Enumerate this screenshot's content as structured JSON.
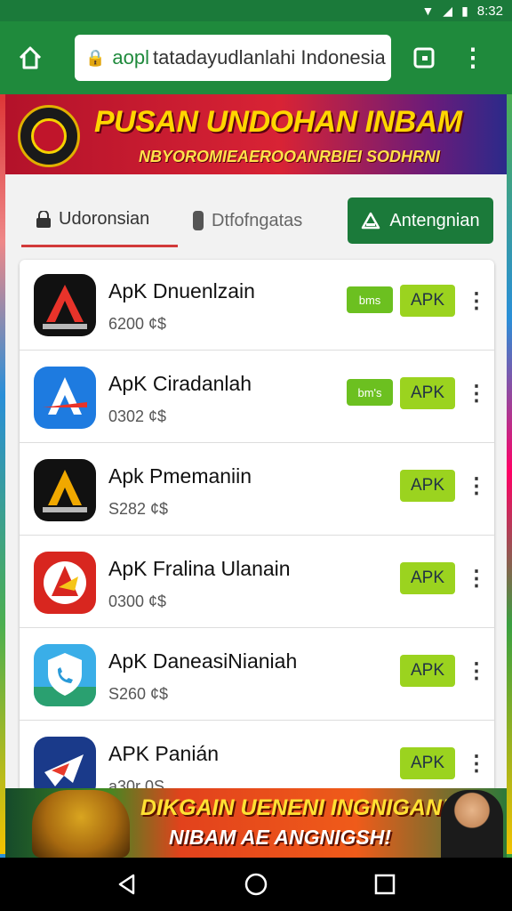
{
  "status_bar": {
    "time": "8:32"
  },
  "browser": {
    "url_scheme": "aopl",
    "url_text": "tatadayudlanlahi Indonesia"
  },
  "banner_top": {
    "title": "PUSAN UNDOHAN INBAM",
    "subtitle": "NBYOROMIEAEROOANRBIEI SODHRNI"
  },
  "tabs": [
    {
      "label": "Udoronsian",
      "icon": "lock-icon"
    },
    {
      "label": "Dtfofngatas",
      "icon": "phone-icon"
    }
  ],
  "download_button": {
    "label": "Antengnian",
    "icon": "triangle-icon"
  },
  "apps": [
    {
      "name": "ApK Dnuenlzain",
      "size": "6200 ¢$",
      "tag": "bms",
      "button": "APK",
      "icon_colors": [
        "#111",
        "#e8332a"
      ]
    },
    {
      "name": "ApK Ciradanlah",
      "size": "0302 ¢$",
      "tag": "bm's",
      "button": "APK",
      "icon_colors": [
        "#1e7be0",
        "#e8332a"
      ]
    },
    {
      "name": "Apk Pmemaniin",
      "size": "S282 ¢$",
      "tag": "",
      "button": "APK",
      "icon_colors": [
        "#111",
        "#f0a800"
      ]
    },
    {
      "name": "ApK Fralina Ulanain",
      "size": "0300 ¢$",
      "tag": "",
      "button": "APK",
      "icon_colors": [
        "#d8261f",
        "#f5c518"
      ]
    },
    {
      "name": "ApK DaneasiNianiah",
      "size": "S260 ¢$",
      "tag": "",
      "button": "APK",
      "icon_colors": [
        "#2a9ad8",
        "#2aa070"
      ]
    },
    {
      "name": "APK Panián",
      "size": "a30r 0S",
      "tag": "",
      "button": "APK",
      "icon_colors": [
        "#1a3a8a",
        "#e83a2a"
      ]
    }
  ],
  "banner_bottom": {
    "line1": "DIKGAIN UENENI INGNIGAN!",
    "line2": "NIBAM AE ANGNIGSH!"
  },
  "colors": {
    "brand_green": "#1f8a3c",
    "apk_button": "#9bd31f",
    "tag": "#6cc020",
    "accent_red": "#d23a3a"
  }
}
